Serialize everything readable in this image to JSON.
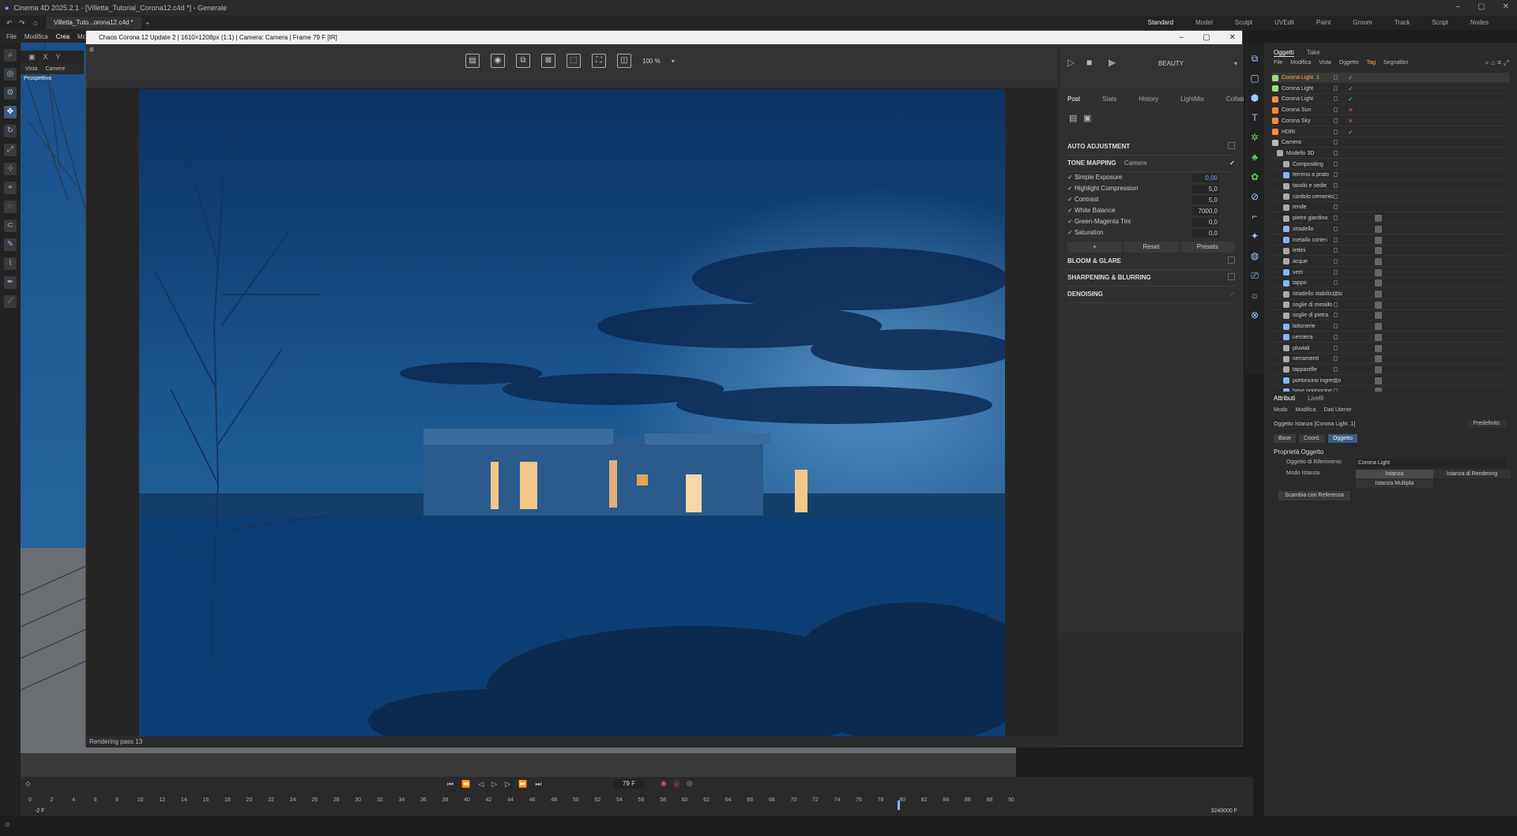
{
  "app": {
    "title": "Cinema 4D 2025.2.1 - [Villetta_Tutorial_Corona12.c4d *] - Generale",
    "doc_tab": "Villetta_Tuto...orona12.c4d *",
    "menu": [
      "File",
      "Modifica",
      "Crea",
      "Mo"
    ],
    "layouts": [
      "Standard",
      "Model",
      "Sculpt",
      "UVEdit",
      "Paint",
      "Groom",
      "Track",
      "Script",
      "Nodes"
    ],
    "selected_layout": "Standard",
    "window_buttons": [
      "–",
      "▢",
      "✕"
    ]
  },
  "viewport": {
    "menu": [
      "Vista",
      "Camere"
    ],
    "label": "Prospettiva",
    "axes": [
      "X",
      "Y"
    ]
  },
  "vfb": {
    "title": "Chaos Corona 12 Update 2 | 1610×1208px (1:1) | Camera: Camera | Frame 79 F [IR]",
    "zoom": "100 %",
    "channel": "BEAUTY",
    "status": "Rendering pass 13",
    "tabs": [
      "Post",
      "Stats",
      "History",
      "LightMix",
      "Collab"
    ],
    "selected_tab": "Post",
    "sections": {
      "auto": "AUTO ADJUSTMENT",
      "tone": "TONE MAPPING",
      "tone_mode": "Camera",
      "bloom": "BLOOM & GLARE",
      "sharpen": "SHARPENING & BLURRING",
      "denoise": "DENOISING"
    },
    "params": [
      {
        "label": "Simple Exposure",
        "value": "0,00"
      },
      {
        "label": "Highlight Compression",
        "value": "5,0"
      },
      {
        "label": "Contrast",
        "value": "5,0"
      },
      {
        "label": "White Balance",
        "value": "7000,0"
      },
      {
        "label": "Green-Magenta Tint",
        "value": "0,0"
      },
      {
        "label": "Saturation",
        "value": "0,0"
      }
    ],
    "buttons": [
      "+",
      "Reset",
      "Presets"
    ]
  },
  "objects": {
    "tabs": [
      "Oggetti",
      "Take"
    ],
    "menu": [
      "File",
      "Modifica",
      "Vista",
      "Oggetto",
      "Tag",
      "Segnalibri"
    ],
    "items": [
      {
        "name": "Corona Light .1",
        "color": "#9be07a",
        "flag": "✓",
        "flag_color": "#5fd35f",
        "sel": true
      },
      {
        "name": "Corona Light",
        "color": "#9be07a",
        "flag": "✓",
        "flag_color": "#5fd35f"
      },
      {
        "name": "Corona Light",
        "color": "#ff8a3a",
        "flag": "✓",
        "flag_color": "#5fd35f"
      },
      {
        "name": "Corona Sun",
        "color": "#ff8a3a",
        "flag": "✕",
        "flag_color": "#e05555"
      },
      {
        "name": "Corona Sky",
        "color": "#ff8a3a",
        "flag": "✕",
        "flag_color": "#e05555"
      },
      {
        "name": "HDRI",
        "color": "#ff8a3a",
        "flag": "✓",
        "flag_color": "#5fd35f"
      },
      {
        "name": "Camera",
        "color": "#bbbbbb",
        "flag": "",
        "flag_color": "#aaa"
      },
      {
        "name": "Modello 3D",
        "color": "#aaaaaa",
        "flag": "",
        "flag_color": "#aaa"
      },
      {
        "name": "Compositing",
        "color": "#aaaaaa",
        "flag": "",
        "flag_color": "#aaa"
      },
      {
        "name": "terreno a prato",
        "color": "#8ab4f8",
        "flag": "",
        "flag_color": "#aaa"
      },
      {
        "name": "tavolo e sedie",
        "color": "#aaaaaa",
        "flag": "",
        "flag_color": "#aaa"
      },
      {
        "name": "cordolo cemento",
        "color": "#aaaaaa",
        "flag": "",
        "flag_color": "#aaa"
      },
      {
        "name": "tende",
        "color": "#aaaaaa",
        "flag": "",
        "flag_color": "#aaa"
      },
      {
        "name": "pietre giardino",
        "color": "#aaaaaa",
        "flag": "",
        "flag_color": "#aaa"
      },
      {
        "name": "stradello",
        "color": "#8ab4f8",
        "flag": "",
        "flag_color": "#aaa"
      },
      {
        "name": "metallo corten",
        "color": "#8ab4f8",
        "flag": "",
        "flag_color": "#aaa"
      },
      {
        "name": "lettini",
        "color": "#aaaaaa",
        "flag": "",
        "flag_color": "#aaa"
      },
      {
        "name": "acque",
        "color": "#aaaaaa",
        "flag": "",
        "flag_color": "#aaa"
      },
      {
        "name": "vetri",
        "color": "#8ab4f8",
        "flag": "",
        "flag_color": "#aaa"
      },
      {
        "name": "tappo",
        "color": "#8ab4f8",
        "flag": "",
        "flag_color": "#aaa"
      },
      {
        "name": "stradello stabilizzato",
        "color": "#aaaaaa",
        "flag": "",
        "flag_color": "#aaa"
      },
      {
        "name": "soglie di metallo",
        "color": "#aaaaaa",
        "flag": "",
        "flag_color": "#aaa"
      },
      {
        "name": "soglie di pietra",
        "color": "#aaaaaa",
        "flag": "",
        "flag_color": "#aaa"
      },
      {
        "name": "lattonerie",
        "color": "#8ab4f8",
        "flag": "",
        "flag_color": "#aaa"
      },
      {
        "name": "cerniera",
        "color": "#8ab4f8",
        "flag": "",
        "flag_color": "#aaa"
      },
      {
        "name": "pluviali",
        "color": "#aaaaaa",
        "flag": "",
        "flag_color": "#aaa"
      },
      {
        "name": "serramenti",
        "color": "#aaaaaa",
        "flag": "",
        "flag_color": "#aaa"
      },
      {
        "name": "tapparelle",
        "color": "#aaaaaa",
        "flag": "",
        "flag_color": "#aaa"
      },
      {
        "name": "portoncino ingresso",
        "color": "#8ab4f8",
        "flag": "",
        "flag_color": "#aaa"
      },
      {
        "name": "base portoncino",
        "color": "#8ab4f8",
        "flag": "",
        "flag_color": "#aaa"
      }
    ]
  },
  "attributes": {
    "tabs": [
      "Attributi",
      "Livelli"
    ],
    "menu": [
      "Modo",
      "Modifica",
      "Dati Utente"
    ],
    "preset": "Predefinito",
    "object": "Oggetto Istanza [Corona Light .1]",
    "subtabs": [
      "Base",
      "Coord.",
      "Oggetto"
    ],
    "selected_subtab": "Oggetto",
    "section": "Proprietà Oggetto",
    "ref_label": "Oggetto di Riferimento",
    "ref_value": "Corona Light",
    "mode_label": "Modo Istanza",
    "mode_options": [
      "Istanza",
      "Istanza di Rendering",
      "Istanza Multipla"
    ],
    "swap": "Scambia con Referenza"
  },
  "timeline": {
    "frame": "79 F",
    "start": "-2 F",
    "end": "3240000 F",
    "ticks": [
      "0",
      "2",
      "4",
      "6",
      "8",
      "10",
      "12",
      "14",
      "16",
      "18",
      "20",
      "22",
      "24",
      "26",
      "28",
      "30",
      "32",
      "34",
      "36",
      "38",
      "40",
      "42",
      "44",
      "46",
      "48",
      "50",
      "52",
      "54",
      "56",
      "58",
      "60",
      "62",
      "64",
      "66",
      "68",
      "70",
      "72",
      "74",
      "76",
      "78",
      "80",
      "82",
      "84",
      "86",
      "88",
      "90"
    ]
  },
  "colors": {
    "accent": "#3d5a86",
    "sky_top": "#0a3262",
    "sky_mid": "#1e5a93",
    "ground": "#0c3e74",
    "window_light": "#f2c78a"
  }
}
